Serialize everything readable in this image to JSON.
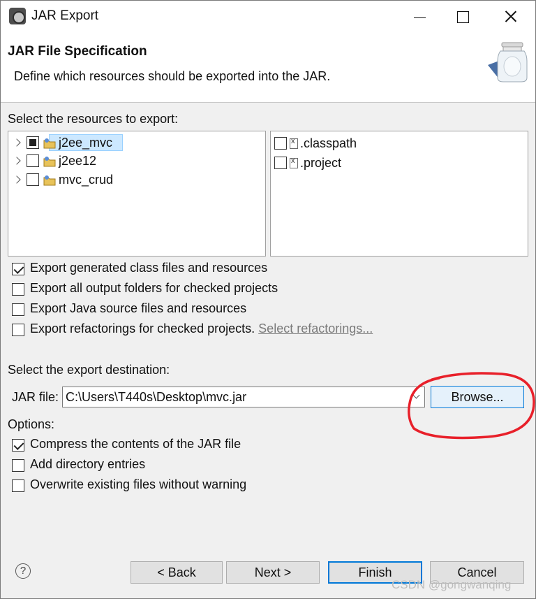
{
  "window": {
    "title": "JAR Export"
  },
  "header": {
    "title": "JAR File Specification",
    "description": "Define which resources should be exported into the JAR."
  },
  "resources": {
    "label": "Select the resources to export:",
    "projects": [
      {
        "name": "j2ee_mvc",
        "state": "partial",
        "selected": true
      },
      {
        "name": "j2ee12",
        "state": "unchecked",
        "selected": false
      },
      {
        "name": "mvc_crud",
        "state": "unchecked",
        "selected": false
      }
    ],
    "files": [
      {
        "name": ".classpath",
        "checked": false
      },
      {
        "name": ".project",
        "checked": false
      }
    ]
  },
  "export_options": [
    {
      "label": "Export generated class files and resources",
      "checked": true
    },
    {
      "label": "Export all output folders for checked projects",
      "checked": false
    },
    {
      "label": "Export Java source files and resources",
      "checked": false
    },
    {
      "label": "Export refactorings for checked projects.",
      "checked": false,
      "link": "Select refactorings..."
    }
  ],
  "destination": {
    "label": "Select the export destination:",
    "jar_label": "JAR file:",
    "jar_value": "C:\\Users\\T440s\\Desktop\\mvc.jar",
    "browse_label": "Browse..."
  },
  "options": {
    "label": "Options:",
    "items": [
      {
        "label": "Compress the contents of the JAR file",
        "checked": true
      },
      {
        "label": "Add directory entries",
        "checked": false
      },
      {
        "label": "Overwrite existing files without warning",
        "checked": false
      }
    ]
  },
  "footer": {
    "help": "?",
    "back": "< Back",
    "next": "Next >",
    "finish": "Finish",
    "cancel": "Cancel"
  },
  "watermark": "CSDN @gongwanqing",
  "colors": {
    "accent": "#0078d7",
    "selection": "#cce8ff",
    "annotation": "#e8202a"
  }
}
